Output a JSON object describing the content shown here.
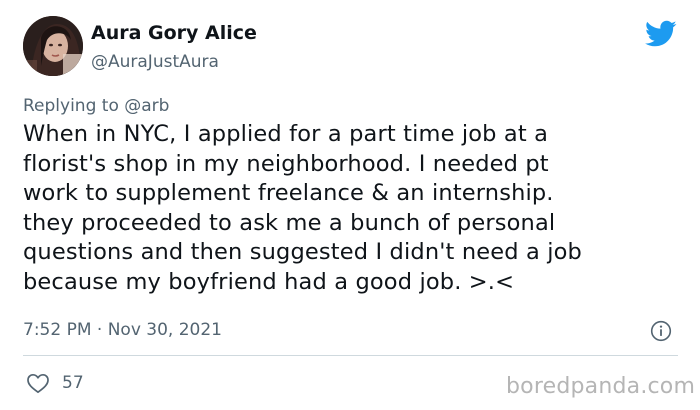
{
  "author": {
    "name": "Aura Gory Alice",
    "handle": "@AuraJustAura"
  },
  "reply": {
    "prefix": "Replying to",
    "mention": "@arb"
  },
  "tweet": {
    "text": "When in NYC, I applied for a part time job at a\nflorist's shop in my neighborhood. I needed pt\nwork to supplement freelance & an internship.\nthey proceeded to ask me a bunch of personal\nquestions and then suggested I didn't need a job\nbecause my boyfriend had a good job. >.<",
    "timestamp": "7:52 PM · Nov 30, 2021",
    "likes": "57"
  },
  "icons": {
    "brand": "twitter-bird-icon",
    "info": "info-icon",
    "like": "heart-icon"
  },
  "colors": {
    "twitter_blue": "#1d9bf0",
    "secondary_text": "#536471",
    "primary_text": "#0f1419",
    "watermark": "#b5b5b5"
  },
  "watermark": "boredpanda.com"
}
